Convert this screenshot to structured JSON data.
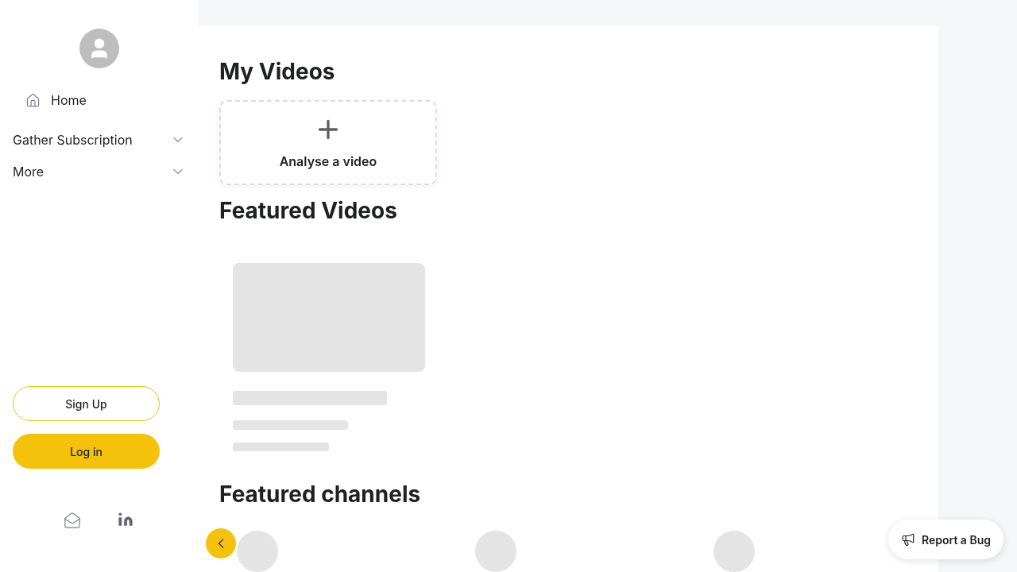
{
  "sidebar": {
    "home": "Home",
    "menus": [
      {
        "label": "Gather Subscription",
        "expanded": false
      },
      {
        "label": "More",
        "expanded": false
      }
    ],
    "buttons": [
      {
        "label": "Sign Up",
        "kind": "outline"
      },
      {
        "label": "Log in",
        "kind": "filled"
      }
    ]
  },
  "sections": [
    {
      "title": "My Videos"
    },
    {
      "title": "Featured Videos"
    },
    {
      "title": "Featured channels"
    }
  ],
  "analyse_card": {
    "label": "Analyse a video"
  },
  "report_button": "Report a Bug"
}
